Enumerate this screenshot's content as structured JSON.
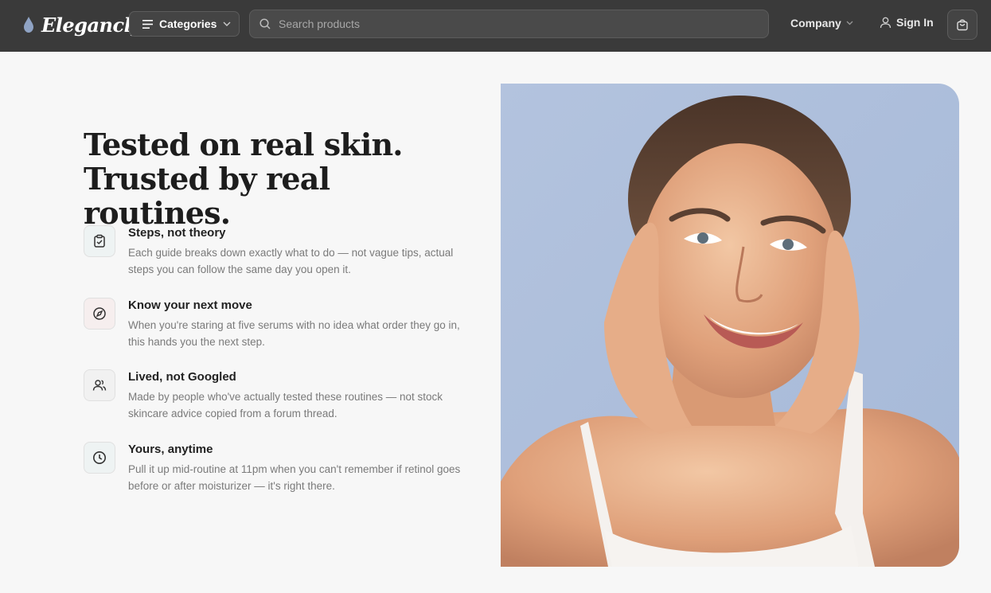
{
  "nav": {
    "logo_text": "Elegancly",
    "categories_label": "Categories",
    "search_placeholder": "Search products",
    "company_label": "Company",
    "signin_label": "Sign In"
  },
  "hero": {
    "heading": "Tested on real skin. Trusted by real routines.",
    "features": [
      {
        "title": "Steps, not theory",
        "description": "Each guide breaks down exactly what to do — not vague tips, actual steps you can follow the same day you open it.",
        "icon": "clipboard-check-icon",
        "icon_bg": "#eef3f3"
      },
      {
        "title": "Know your next move",
        "description": "When you're staring at five serums with no idea what order they go in, this hands you the next step.",
        "icon": "compass-icon",
        "icon_bg": "#f6eeee"
      },
      {
        "title": "Lived, not Googled",
        "description": "Made by people who've actually tested these routines — not stock skincare advice copied from a forum thread.",
        "icon": "users-icon",
        "icon_bg": "#f1f1f1"
      },
      {
        "title": "Yours, anytime",
        "description": "Pull it up mid-routine at 11pm when you can't remember if retinol goes before or after moisturizer — it's right there.",
        "icon": "clock-icon",
        "icon_bg": "#eef3f3"
      }
    ]
  },
  "colors": {
    "nav_bg": "#3a3a3a",
    "page_bg": "#f7f7f7",
    "photo_bg": "#adbfdc"
  }
}
